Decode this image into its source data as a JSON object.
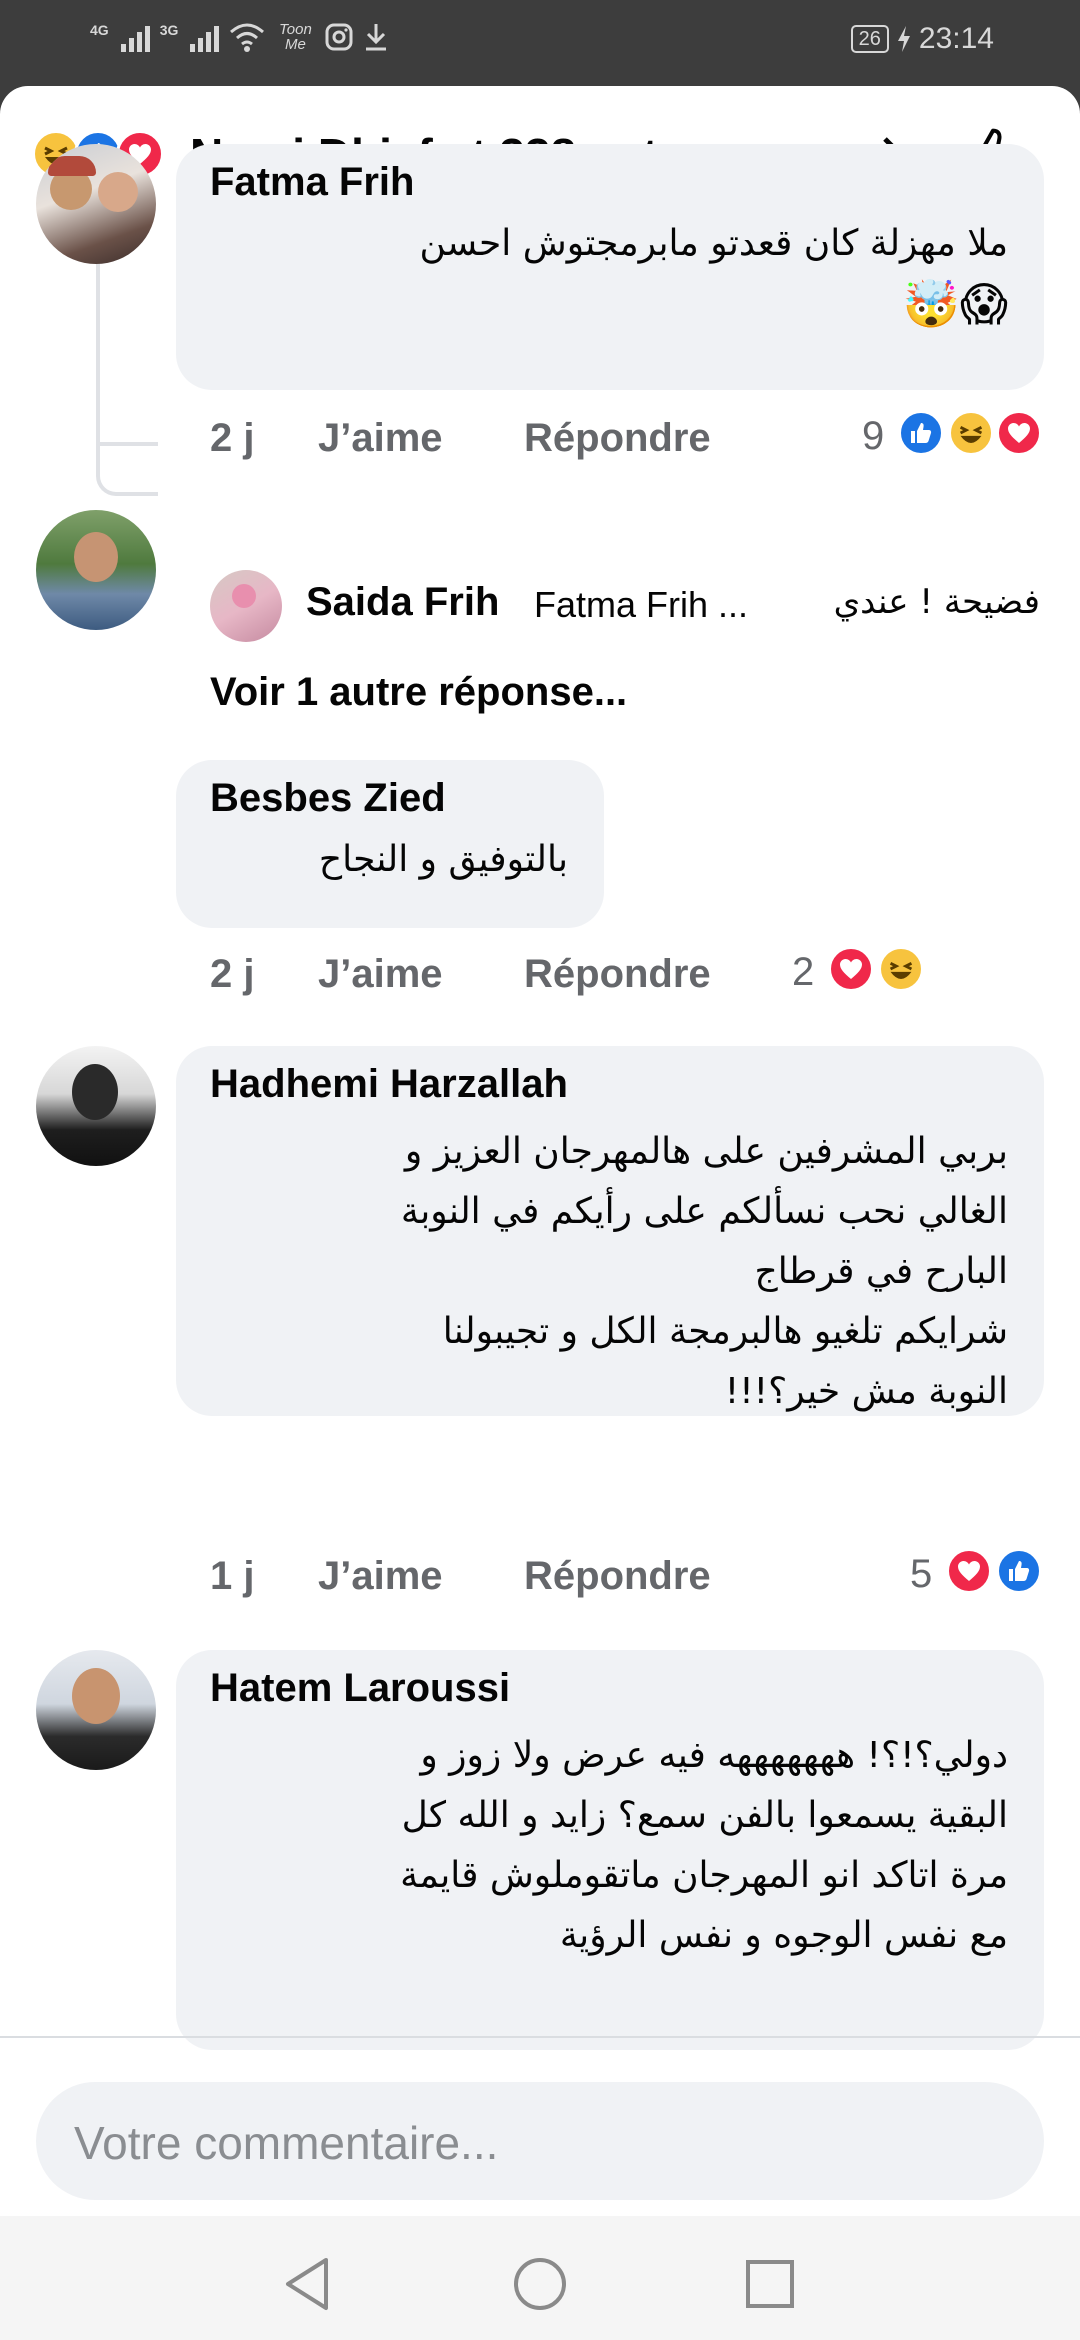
{
  "status_bar": {
    "network_1": "4G",
    "network_2": "3G",
    "app_tag": "Toon Me",
    "battery": "26",
    "time": "23:14"
  },
  "header": {
    "title": "Nasri Dhiaf et 338 autres..."
  },
  "comments": [
    {
      "author": "Fatma Frih",
      "lines": [
        "ملا مهزلة كان قعدتو مابرمجتوش احسن",
        "😱🤯"
      ],
      "time": "2 j",
      "like": "J’aime",
      "reply": "Répondre",
      "reaction_count": "9",
      "reactions": [
        "like",
        "haha",
        "love"
      ]
    },
    {
      "author": "Besbes Zied",
      "lines": [
        "بالتوفيق و النجاح"
      ],
      "time": "2 j",
      "like": "J’aime",
      "reply": "Répondre",
      "reaction_count": "2",
      "reactions": [
        "love",
        "haha"
      ]
    },
    {
      "author": "Hadhemi Harzallah",
      "lines": [
        "بربي المشرفين على هالمهرجان العزيز و",
        "الغالي نحب نسألكم على رأيكم في النوبة",
        "البارح في قرطاج",
        "شرايكم تلغيو هالبرمجة الكل و تجيبولنا",
        "النوبة مش خير؟!!!"
      ],
      "time": "1 j",
      "like": "J’aime",
      "reply": "Répondre",
      "reaction_count": "5",
      "reactions": [
        "love",
        "like"
      ]
    },
    {
      "author": "Hatem Laroussi",
      "lines": [
        "دولي؟!؟! هههههههه فيه عرض ولا زوز و",
        "البقية يسمعوا بالفن سمع؟ زايد و الله كل",
        "مرة اتاكد انو المهرجان ماتقوملوش قايمة",
        "مع نفس الوجوه و نفس الرؤية"
      ]
    }
  ],
  "reply_preview": {
    "author": "Saida Frih",
    "mention": "Fatma Frih ...",
    "text": "فضيحة ! عندي"
  },
  "more_replies": "Voir 1 autre réponse...",
  "comment_input": {
    "placeholder": "Votre commentaire..."
  },
  "colors": {
    "accent": "#1b74e4",
    "love": "#f0284a",
    "haha": "#f7c33e",
    "bubble": "#f0f2f5",
    "meta": "#65676b"
  }
}
